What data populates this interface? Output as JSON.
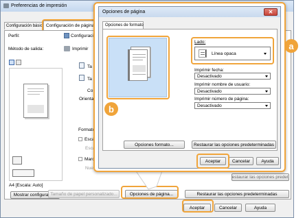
{
  "back": {
    "title": "Preferencias de impresión",
    "tabs": [
      "Configuración básica",
      "Configuración de página"
    ],
    "perfil_label": "Perfil:",
    "perfil_value": "Configuración",
    "metodo_label": "Método de salida:",
    "metodo_value": "Imprimir",
    "side_labels": [
      "Ta",
      "Ta",
      "Co",
      "Orientac"
    ],
    "formato_label": "Formato d",
    "escala_label": "Escala",
    "escala_value": "Escal",
    "marca_label": "Marca",
    "marca_value": "Nueva",
    "preview_caption": "A4 [Escala: Auto]",
    "mostrar_button": "Mostrar configuración",
    "custom_size_button": "Tamaño de papel personalizado...",
    "page_options_button": "Opciones de página...",
    "restore_button": "Restaurar las opciones predeterminadas",
    "ghost_button": "Restaurar las opciones predet...",
    "ok_button": "Aceptar",
    "cancel_button": "Cancelar",
    "help_button": "Ayuda"
  },
  "dialog": {
    "title": "Opciones de página",
    "tab": "Opciones de formato",
    "lado_label": "Lado:",
    "lado_value": "Línea opaca",
    "fecha_label": "Imprimir fecha:",
    "fecha_value": "Desactivado",
    "usuario_label": "Imprimir nombre de usuario:",
    "usuario_value": "Desactivado",
    "numero_label": "Imprimir número de página:",
    "numero_value": "Desactivado",
    "formato_button": "Opciones formato...",
    "restore_button": "Restaurar las opciones predeterminadas",
    "ok_button": "Aceptar",
    "cancel_button": "Cancelar",
    "help_button": "Ayuda"
  },
  "callouts": {
    "a": "a",
    "b": "b"
  },
  "colors": {
    "accent": "#f0a43a",
    "close": "#c9443a",
    "titlebar": "#d8e6f5"
  }
}
